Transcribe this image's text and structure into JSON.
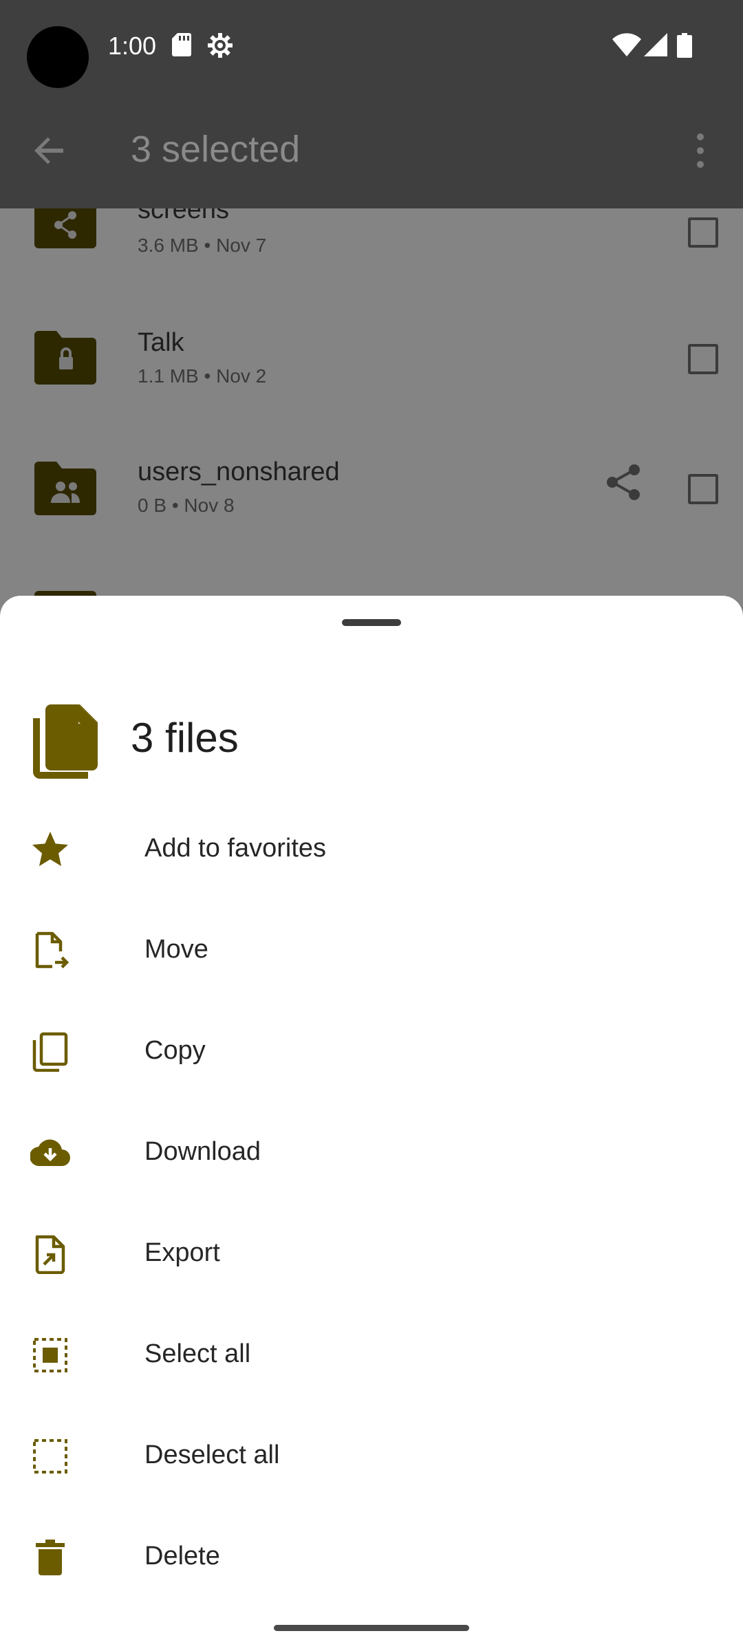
{
  "status_bar": {
    "time": "1:00",
    "icons": [
      "sd-card-icon",
      "settings-gear-icon",
      "wifi-icon",
      "cell-signal-icon",
      "battery-icon"
    ]
  },
  "app_bar": {
    "title": "3 selected",
    "back_icon": "arrow-back-icon",
    "menu_icon": "more-vert-icon"
  },
  "files": [
    {
      "name": "screens",
      "size": "3.6 MB",
      "date": "Nov 7",
      "folder_icon": "shared-folder-icon",
      "shared": false
    },
    {
      "name": "Talk",
      "size": "1.1 MB",
      "date": "Nov 2",
      "folder_icon": "locked-folder-icon",
      "shared": false
    },
    {
      "name": "users_nonshared",
      "size": "0 B",
      "date": "Nov 8",
      "folder_icon": "group-folder-icon",
      "shared": true
    }
  ],
  "meta_separator": "•",
  "sheet": {
    "title": "3 files",
    "header_icon": "files-icon",
    "actions": [
      {
        "label": "Add to favorites",
        "icon": "star-icon"
      },
      {
        "label": "Move",
        "icon": "move-file-icon"
      },
      {
        "label": "Copy",
        "icon": "copy-icon"
      },
      {
        "label": "Download",
        "icon": "cloud-download-icon"
      },
      {
        "label": "Export",
        "icon": "export-icon"
      },
      {
        "label": "Select all",
        "icon": "select-all-icon"
      },
      {
        "label": "Deselect all",
        "icon": "deselect-all-icon"
      },
      {
        "label": "Delete",
        "icon": "trash-icon"
      }
    ]
  },
  "colors": {
    "accent": "#6b5c00",
    "scrim_bar": "#3f3f3f",
    "scrim_list": "#848484"
  }
}
